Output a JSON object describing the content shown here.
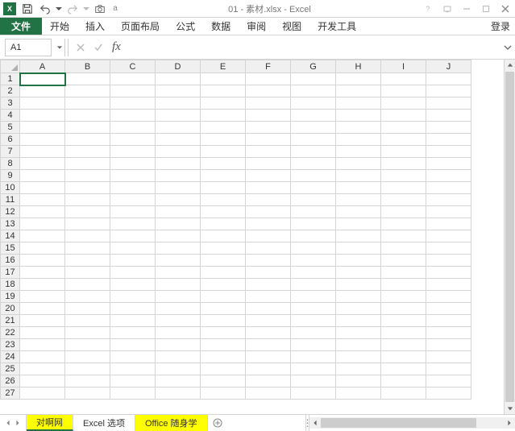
{
  "title": "01 - 素材.xlsx - Excel",
  "login": "登录",
  "ribbon": {
    "file": "文件",
    "tabs": [
      "开始",
      "插入",
      "页面布局",
      "公式",
      "数据",
      "审阅",
      "视图",
      "开发工具"
    ]
  },
  "qat": {
    "customize": "a"
  },
  "name_box": "A1",
  "fx_label": "fx",
  "formula": "",
  "columns": [
    "A",
    "B",
    "C",
    "D",
    "E",
    "F",
    "G",
    "H",
    "I",
    "J"
  ],
  "rows": [
    "1",
    "2",
    "3",
    "4",
    "5",
    "6",
    "7",
    "8",
    "9",
    "10",
    "11",
    "12",
    "13",
    "14",
    "15",
    "16",
    "17",
    "18",
    "19",
    "20",
    "21",
    "22",
    "23",
    "24",
    "25",
    "26",
    "27"
  ],
  "active_cell": "A1",
  "sheet_tabs": [
    {
      "label": "对啊网",
      "active": true,
      "yellow": true
    },
    {
      "label": "Excel 选项",
      "active": false,
      "yellow": false
    },
    {
      "label": "Office 随身学",
      "active": false,
      "yellow": true
    }
  ]
}
